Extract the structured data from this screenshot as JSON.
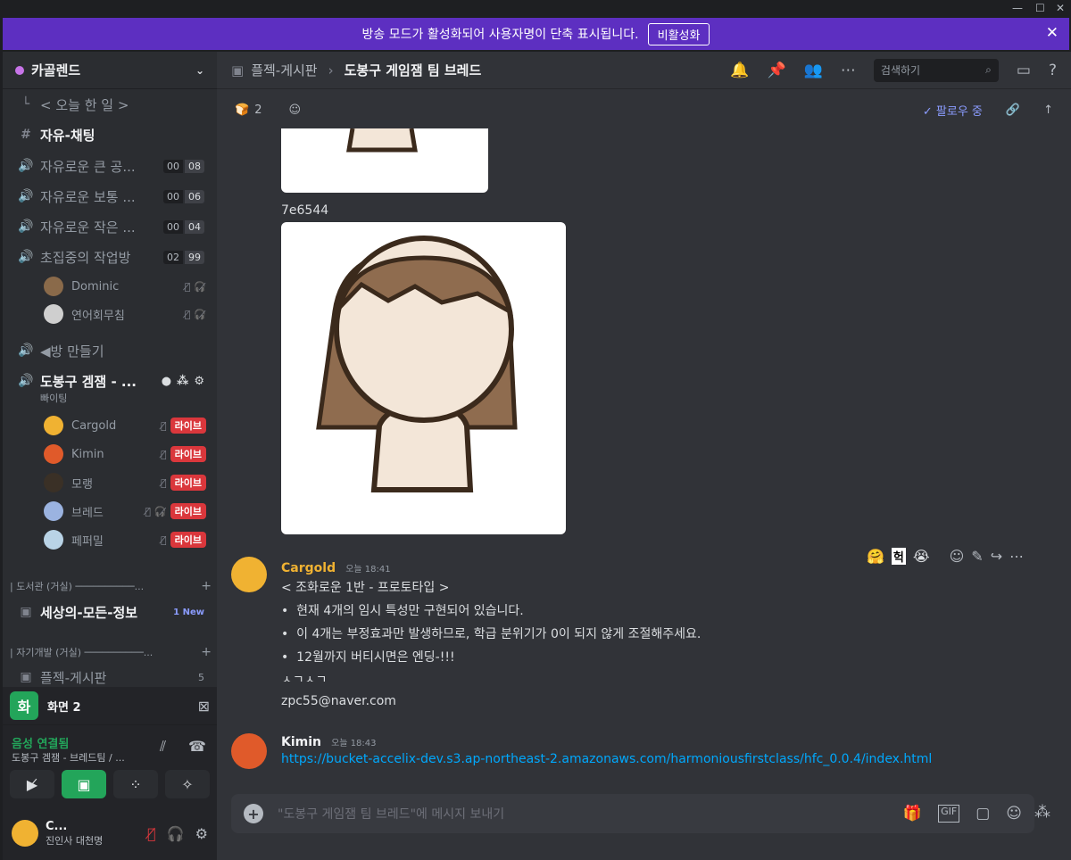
{
  "banner": {
    "text": "방송 모드가 활성화되어 사용자명이 단축 표시됩니다.",
    "button": "비활성화"
  },
  "server": {
    "name": "카골렌드"
  },
  "sidebar": {
    "channels": [
      {
        "name": "< 오늘 한 일 >"
      },
      {
        "name": "자유-채팅"
      },
      {
        "name": "자유로운 큰 공...",
        "a": "00",
        "b": "08"
      },
      {
        "name": "자유로운 보통 ...",
        "a": "00",
        "b": "06"
      },
      {
        "name": "자유로운 작은 ...",
        "a": "00",
        "b": "04"
      },
      {
        "name": "초집중의 작업방",
        "a": "02",
        "b": "99"
      }
    ],
    "room_users": [
      {
        "name": "Dominic"
      },
      {
        "name": "연어회무침"
      }
    ],
    "make_room": "◀방 만들기",
    "active_voice": {
      "name": "도봉구 겜잼 - ...",
      "sub": "빠이팅"
    },
    "live_label": "라이브",
    "voice_users": [
      {
        "name": "Cargold"
      },
      {
        "name": "Kimin"
      },
      {
        "name": "모랭"
      },
      {
        "name": "브레드"
      },
      {
        "name": "페퍼밀"
      }
    ],
    "cat1": "| 도서관 (거실) ──────────...",
    "info_channel": "세상의-모든-정보",
    "info_badge": "1 New",
    "cat2": "| 자기개발 (거실) ──────────...",
    "forum_channel": "플젝-게시판",
    "forum_count": "5"
  },
  "screen_share": {
    "label": "화면 2"
  },
  "voice_connected": {
    "status": "음성 연결됨",
    "channel": "도봉구 겜잼 - 브레드팀 / ..."
  },
  "me": {
    "name": "C...",
    "status": "진인사 대천명"
  },
  "header": {
    "forum": "플젝-게시판",
    "thread": "도봉구 게임잼 팀 브레드",
    "search_placeholder": "검색하기",
    "reaction_count": "2",
    "follow": "팔로우 중"
  },
  "messages": {
    "caption": "7e6544",
    "cargold": {
      "author": "Cargold",
      "time": "오늘 18:41",
      "lines": [
        "< 조화로운 1반 - 프로토타입 >",
        "현재 4개의 임시 특성만 구현되어 있습니다.",
        "이 4개는 부정효과만 발생하므로, 학급 분위기가 0이 되지 않게 조절해주세요.",
        "12월까지 버티시면은 엔딩-!!!",
        "ㅅㄱㅅㄱ",
        "zpc55@naver.com"
      ]
    },
    "kimin": {
      "author": "Kimin",
      "time": "오늘 18:43",
      "link": "https://bucket-accelix-dev.s3.ap-northeast-2.amazonaws.com/harmoniousfirstclass/hfc_0.0.4/index.html"
    }
  },
  "composer": {
    "placeholder": "\"도봉구 게임잼 팀 브레드\"에 메시지 보내기"
  },
  "colors": {
    "accent": "#5d2fc1",
    "cargold": "#f0b232",
    "link": "#00a8fc",
    "live": "#da373c",
    "green": "#23a55a"
  }
}
